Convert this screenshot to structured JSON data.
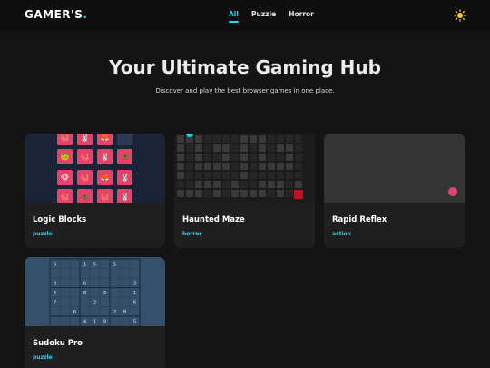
{
  "header": {
    "logo_text": "GAMER'S",
    "logo_dot": ".",
    "nav": [
      {
        "label": "All",
        "active": true
      },
      {
        "label": "Puzzle",
        "active": false
      },
      {
        "label": "Horror",
        "active": false
      }
    ],
    "theme_icon": "sun-icon"
  },
  "hero": {
    "title": "Your Ultimate Gaming Hub",
    "subtitle": "Discover and play the best browser games in one place."
  },
  "games": [
    {
      "title": "Logic Blocks",
      "tag": "puzzle"
    },
    {
      "title": "Haunted Maze",
      "tag": "horror"
    },
    {
      "title": "Rapid Reflex",
      "tag": "action"
    },
    {
      "title": "Sudoku Pro",
      "tag": "puzzle"
    }
  ],
  "logic_tiles": [
    "🐙",
    "🐰",
    "🦊",
    "🐸",
    "🐙",
    "🐰",
    "🦋",
    "🐵",
    "🐙",
    "🦊",
    "🐰",
    "🐙",
    "🦋"
  ],
  "sudoku_rows": [
    [
      "6",
      "",
      "",
      "1",
      "5",
      "",
      "5",
      "",
      ""
    ],
    [
      "",
      "",
      "",
      "",
      "",
      "",
      "",
      "",
      ""
    ],
    [
      "8",
      "",
      "",
      "6",
      "",
      "",
      "",
      "",
      "3"
    ],
    [
      "4",
      "",
      "",
      "8",
      "",
      "3",
      "",
      "",
      "1"
    ],
    [
      "7",
      "",
      "",
      "",
      "2",
      "",
      "",
      "",
      "6"
    ],
    [
      "",
      "",
      "6",
      "",
      "",
      "",
      "2",
      "8",
      ""
    ],
    [
      "",
      "",
      "",
      "4",
      "1",
      "9",
      "",
      "",
      "5"
    ],
    [
      "",
      "",
      "",
      "",
      "",
      "",
      "",
      "",
      ""
    ]
  ],
  "colors": {
    "accent": "#22d3ee",
    "tile": "#e5436a",
    "reflex_dot": "#e5436a",
    "maze_exit": "#c1121f"
  }
}
